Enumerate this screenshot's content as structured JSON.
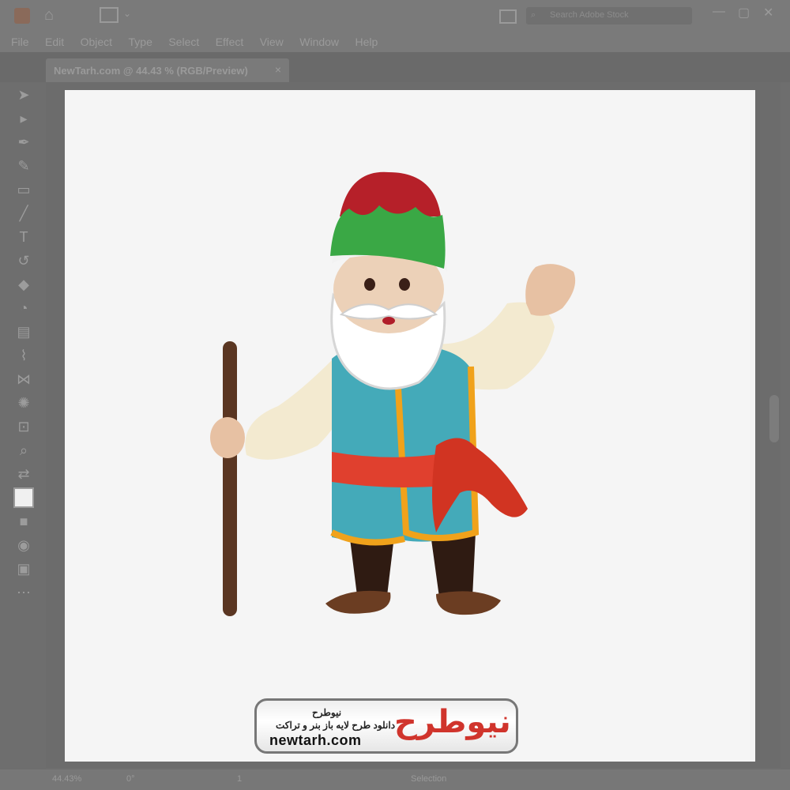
{
  "window": {
    "search_placeholder": "Search Adobe Stock"
  },
  "menu": [
    "File",
    "Edit",
    "Object",
    "Type",
    "Select",
    "Effect",
    "View",
    "Window",
    "Help"
  ],
  "document_tab": {
    "title": "NewTarh.com @ 44.43 % (RGB/Preview)",
    "close": "×"
  },
  "tools": [
    "selection-tool",
    "direct-selection-tool",
    "pen-tool",
    "curvature-tool",
    "rectangle-tool",
    "paintbrush-tool",
    "type-tool",
    "rotate-tool",
    "eraser-tool",
    "shape-builder-tool",
    "gradient-tool",
    "eyedropper-tool",
    "blend-tool",
    "symbol-sprayer-tool",
    "artboard-tool",
    "hand-tool",
    "zoom-tool",
    "fill-stroke-swatch",
    "draw-mode",
    "screen-mode",
    "edit-toolbar"
  ],
  "status": {
    "zoom": "44.43%",
    "rotation": "0°",
    "page": "1",
    "tool": "Selection"
  },
  "watermark": {
    "brand": "نیوطرح",
    "title_fa": "نیوطرح",
    "subtitle_fa": "دانلود طرح لایه باز بنر و تراکت",
    "url": "newtarh.com"
  },
  "colors": {
    "hat_red": "#b62029",
    "hat_green": "#3aa845",
    "vest": "#44aab9",
    "sash": "#e0402e",
    "shirt": "#f3ead0",
    "staff": "#5a3622",
    "boots": "#6b3d22",
    "pants": "#2f1b12"
  }
}
